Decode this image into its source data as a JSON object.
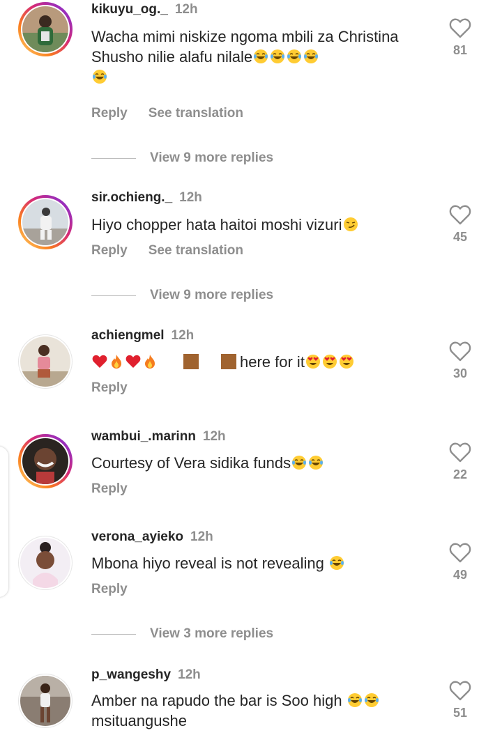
{
  "comments": [
    {
      "username": "kikuyu_og._",
      "time": "12h",
      "text": "Wacha mimi niskize ngoma mbili za Christina Shusho nilie alafu nilale",
      "emojis": [
        "joy",
        "joy",
        "joy",
        "joy",
        "joy"
      ],
      "reply_label": "Reply",
      "translate_label": "See translation",
      "likes": "81",
      "view_more": "View 9 more replies",
      "avatar_ring": "story"
    },
    {
      "username": "sir.ochieng._",
      "time": "12h",
      "text": "Hiyo chopper hata haitoi moshi vizuri",
      "emojis": [
        "smirk"
      ],
      "reply_label": "Reply",
      "translate_label": "See translation",
      "likes": "45",
      "view_more": "View 9 more replies",
      "avatar_ring": "story"
    },
    {
      "username": "achiengmel",
      "time": "12h",
      "text_prefix_emojis": [
        "heart",
        "fire",
        "heart",
        "fire"
      ],
      "text": "here for it",
      "emojis": [
        "heart-eyes",
        "heart-eyes",
        "heart-eyes"
      ],
      "reply_label": "Reply",
      "likes": "30",
      "avatar_ring": "plain"
    },
    {
      "username": "wambui_.marinn",
      "time": "12h",
      "text": "Courtesy of Vera sidika funds",
      "emojis": [
        "joy",
        "joy"
      ],
      "reply_label": "Reply",
      "likes": "22",
      "avatar_ring": "story"
    },
    {
      "username": "verona_ayieko",
      "time": "12h",
      "text": "Mbona hiyo reveal is not revealing",
      "emojis": [
        "joy"
      ],
      "reply_label": "Reply",
      "likes": "49",
      "view_more": "View 3 more replies",
      "avatar_ring": "plain"
    },
    {
      "username": "p_wangeshy",
      "time": "12h",
      "text": "Amber na rapudo the bar is Soo high",
      "text_line2": "msituangushe",
      "emojis": [
        "joy",
        "joy"
      ],
      "likes": "51",
      "avatar_ring": "plain"
    }
  ],
  "colors": {
    "text": "#262626",
    "secondary": "#8e8e8e",
    "background": "#ffffff"
  },
  "icons": {
    "like": "heart-outline-icon"
  }
}
